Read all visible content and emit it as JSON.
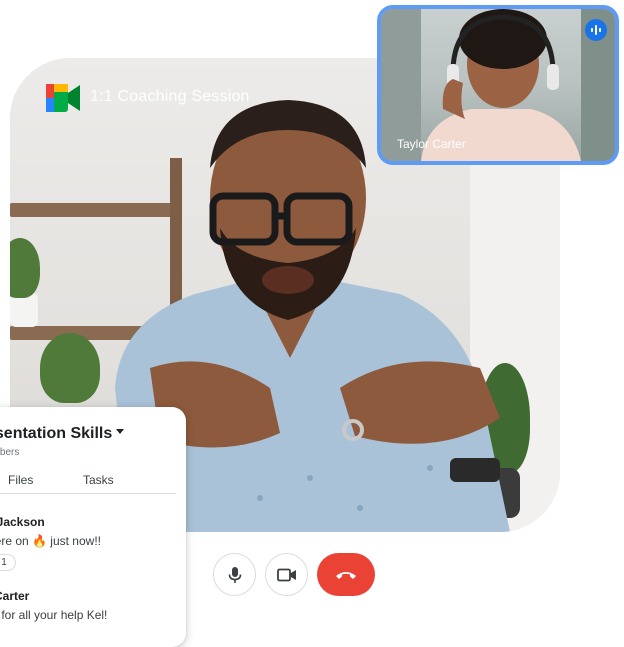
{
  "meeting": {
    "title": "1:1 Coaching Session"
  },
  "participant_thumb": {
    "name": "Taylor Carter",
    "speaking_icon": "audio-wave-icon",
    "highlight_color": "#5e9bf5"
  },
  "controls": {
    "mic_icon": "microphone-icon",
    "camera_icon": "video-camera-icon",
    "end_icon": "phone-hangup-icon",
    "end_color": "#ea4335"
  },
  "chat": {
    "room_title": "esentation Skills",
    "room_subtitle": "embers",
    "tabs": [
      {
        "label": "Files"
      },
      {
        "label": "Tasks"
      }
    ],
    "messages": [
      {
        "sender": "n Jackson",
        "text": "were on 🔥 just now!!",
        "reaction_count": "1"
      },
      {
        "sender": "r Carter",
        "text": "ks for all your help Kel!"
      }
    ]
  }
}
